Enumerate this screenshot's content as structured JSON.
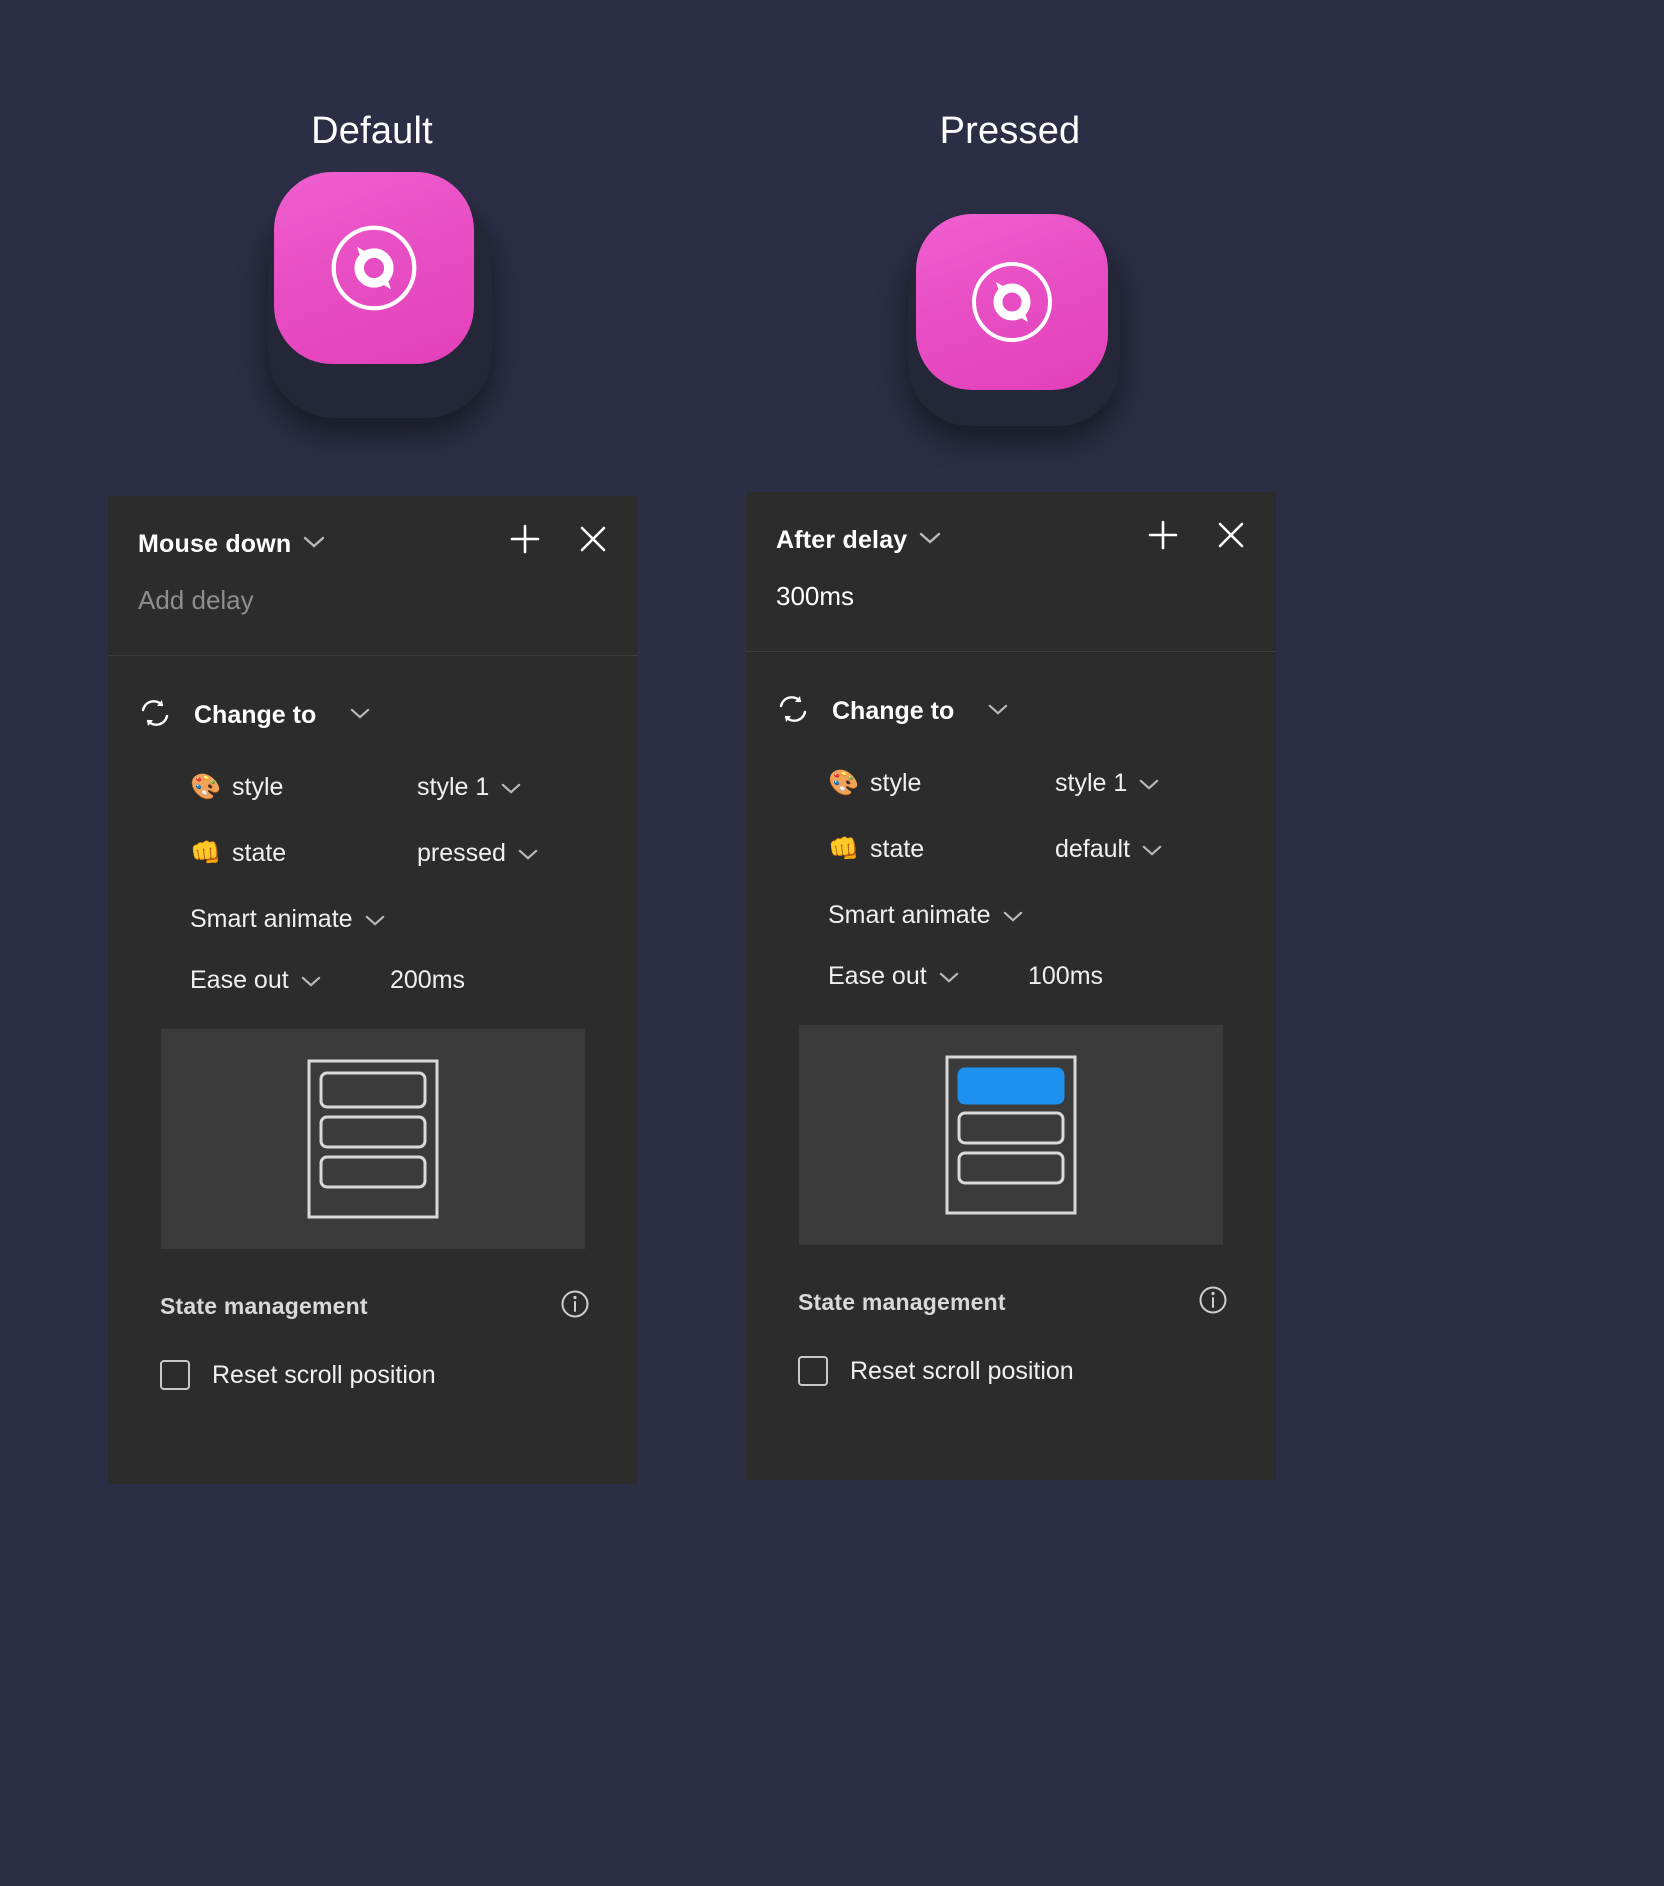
{
  "headings": {
    "default": "Default",
    "pressed": "Pressed"
  },
  "colors": {
    "canvas_bg": "#2b2e44",
    "panel_bg": "#2c2c2c",
    "button_pink": "#e84fc4",
    "button_shadow": "#242738",
    "preview_bg": "#3b3b3b",
    "preview_accent_blue": "#1e90f0",
    "text_primary": "#ffffff",
    "text_muted": "#8e8e8e"
  },
  "buttons": [
    {
      "name": "default-state-button",
      "icon": "disc-icon",
      "state": "raised"
    },
    {
      "name": "pressed-state-button",
      "icon": "disc-icon",
      "state": "pressed"
    }
  ],
  "panels": [
    {
      "id": "left",
      "trigger": "Mouse down",
      "trigger_chevron": "chevron-down-icon",
      "add_button": "add-interaction-button",
      "close_button": "close-panel-button",
      "delay_value": "Add delay",
      "delay_is_placeholder": true,
      "action": {
        "icon": "change-to-icon",
        "label": "Change to",
        "chevron": "chevron-down-icon"
      },
      "properties": [
        {
          "emoji": "🎨",
          "emoji_name": "palette-emoji",
          "name": "style",
          "value": "style 1"
        },
        {
          "emoji": "👊",
          "emoji_name": "fist-emoji",
          "name": "state",
          "value": "pressed"
        }
      ],
      "animation_type": "Smart animate",
      "easing": "Ease out",
      "duration": "200ms",
      "preview": {
        "name": "transition-preview-default",
        "highlight_index": -1,
        "rows": 3
      },
      "state_management": {
        "title": "State management",
        "info_icon": "info-icon",
        "checkbox_label": "Reset scroll position",
        "checked": false
      }
    },
    {
      "id": "right",
      "trigger": "After delay",
      "trigger_chevron": "chevron-down-icon",
      "add_button": "add-interaction-button",
      "close_button": "close-panel-button",
      "delay_value": "300ms",
      "delay_is_placeholder": false,
      "action": {
        "icon": "change-to-icon",
        "label": "Change to",
        "chevron": "chevron-down-icon"
      },
      "properties": [
        {
          "emoji": "🎨",
          "emoji_name": "palette-emoji",
          "name": "style",
          "value": "style 1"
        },
        {
          "emoji": "👊",
          "emoji_name": "fist-emoji",
          "name": "state",
          "value": "default"
        }
      ],
      "animation_type": "Smart animate",
      "easing": "Ease out",
      "duration": "100ms",
      "preview": {
        "name": "transition-preview-pressed",
        "highlight_index": 0,
        "rows": 3
      },
      "state_management": {
        "title": "State management",
        "info_icon": "info-icon",
        "checkbox_label": "Reset scroll position",
        "checked": false
      }
    }
  ]
}
